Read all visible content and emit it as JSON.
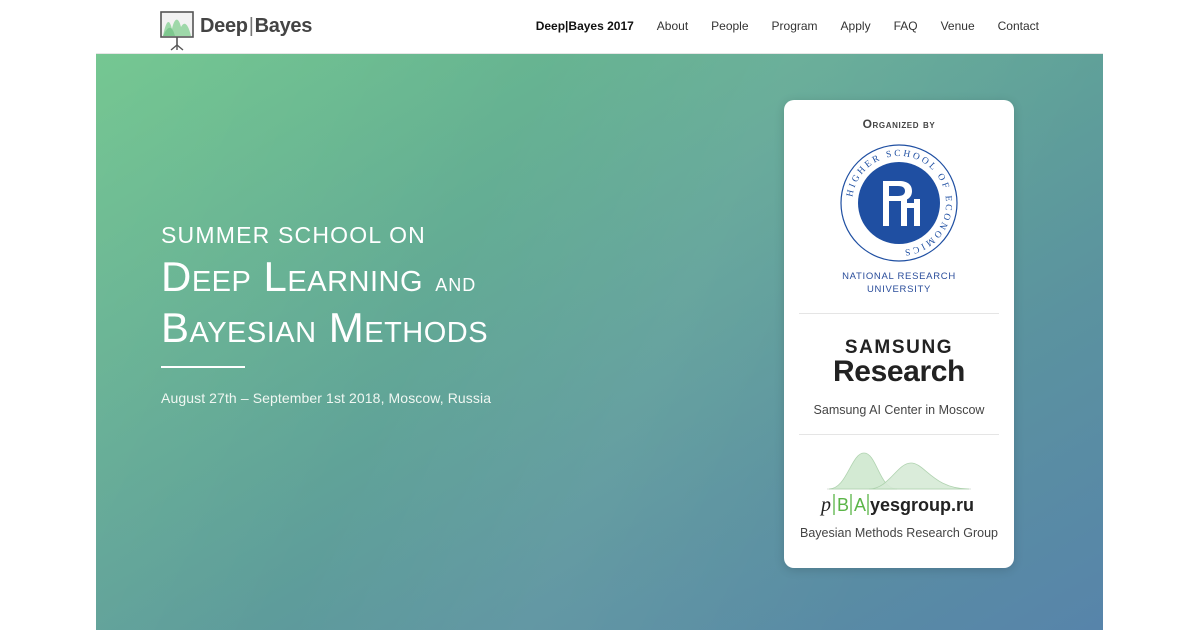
{
  "header": {
    "logo_word_left": "Deep",
    "logo_separator": "|",
    "logo_word_right": "Bayes",
    "nav": [
      {
        "label": "Deep|Bayes 2017"
      },
      {
        "label": "About"
      },
      {
        "label": "People"
      },
      {
        "label": "Program"
      },
      {
        "label": "Apply"
      },
      {
        "label": "FAQ"
      },
      {
        "label": "Venue"
      },
      {
        "label": "Contact"
      }
    ]
  },
  "hero": {
    "kicker": "SUMMER SCHOOL ON",
    "title_line1": "Deep Learning",
    "title_line1_suffix": "and",
    "title_line2": "Bayesian Methods",
    "dates": "August 27th – September 1st 2018, Moscow, Russia"
  },
  "organizers": {
    "heading": "Organized by",
    "hse": {
      "ring_text": "HIGHER SCHOOL OF ECONOMICS",
      "caption_line1": "NATIONAL RESEARCH",
      "caption_line2": "UNIVERSITY"
    },
    "samsung": {
      "word1": "SAMSUNG",
      "word2": "Research",
      "caption": "Samsung AI Center in Moscow"
    },
    "bayes": {
      "logo_p": "p",
      "logo_b": "B",
      "logo_a": "A",
      "logo_rest": "yesgroup.ru",
      "caption": "Bayesian Methods Research Group"
    }
  },
  "colors": {
    "hse_blue": "#1f4fa2",
    "bayes_green": "#5bb548",
    "hero_start": "#6dc48b",
    "hero_end": "#5784aa"
  }
}
